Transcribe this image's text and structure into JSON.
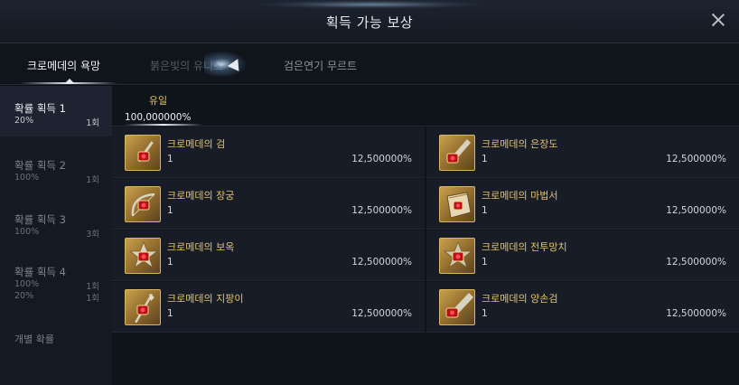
{
  "window": {
    "title": "획득 가능 보상"
  },
  "tabs": [
    {
      "label": "크로메데의 욕망",
      "active": true
    },
    {
      "label": "붉은빛의 유니스",
      "active": false
    },
    {
      "label": "검은연기 무르트",
      "active": false
    }
  ],
  "sidebar": {
    "groups": [
      {
        "title": "확률 획득 1",
        "active": true,
        "rows": [
          {
            "rate": "20%",
            "count": "1회"
          }
        ]
      },
      {
        "title": "확률 획득 2",
        "active": false,
        "rows": [
          {
            "rate": "100%",
            "count": "1회"
          }
        ]
      },
      {
        "title": "확률 획득 3",
        "active": false,
        "rows": [
          {
            "rate": "100%",
            "count": "3회"
          }
        ]
      },
      {
        "title": "확률 획득 4",
        "active": false,
        "rows": [
          {
            "rate": "100%",
            "count": "1회"
          },
          {
            "rate": "20%",
            "count": "1회"
          }
        ]
      }
    ],
    "link": "개별 확률"
  },
  "subtab": {
    "label": "유일",
    "value": "100,000000%"
  },
  "items": [
    {
      "name": "크로메데의 검",
      "qty": "1",
      "prob": "12,500000%",
      "icon": "sword-icon"
    },
    {
      "name": "크로메데의 은장도",
      "qty": "1",
      "prob": "12,500000%",
      "icon": "dagger-icon"
    },
    {
      "name": "크로메데의 장궁",
      "qty": "1",
      "prob": "12,500000%",
      "icon": "bow-icon"
    },
    {
      "name": "크로메데의 마법서",
      "qty": "1",
      "prob": "12,500000%",
      "icon": "spellbook-icon"
    },
    {
      "name": "크로메데의 보옥",
      "qty": "1",
      "prob": "12,500000%",
      "icon": "orb-icon"
    },
    {
      "name": "크로메데의 전투망치",
      "qty": "1",
      "prob": "12,500000%",
      "icon": "warhammer-icon"
    },
    {
      "name": "크로메데의 지팡이",
      "qty": "1",
      "prob": "12,500000%",
      "icon": "staff-icon"
    },
    {
      "name": "크로메데의 양손검",
      "qty": "1",
      "prob": "12,500000%",
      "icon": "greatsword-icon"
    }
  ],
  "colors": {
    "gold": "#e2c36b",
    "panel": "#171c26",
    "background": "#0d1017"
  }
}
